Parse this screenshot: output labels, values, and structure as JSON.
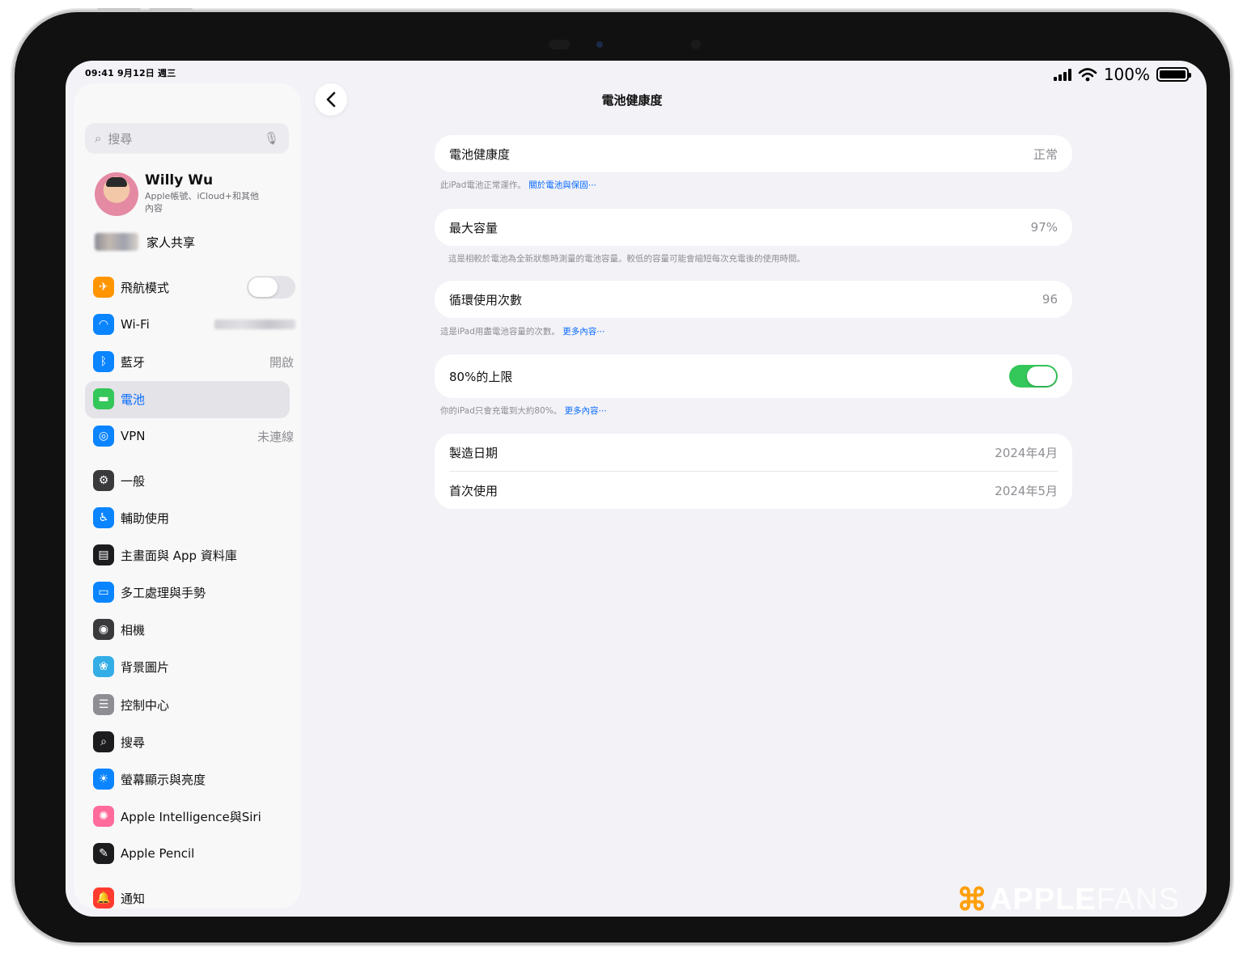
{
  "status_bar": {
    "time_date": "09:41  9月12日 週三",
    "battery_percent": "100%"
  },
  "sidebar": {
    "search_placeholder": "搜尋",
    "profile": {
      "name": "Willy Wu",
      "subtitle": "Apple帳號、iCloud+和其他內容"
    },
    "family_label": "家人共享",
    "items": [
      {
        "label": "飛航模式",
        "icon": "airplane-icon",
        "color": "#ff9500",
        "glyph": "✈",
        "toggle": false
      },
      {
        "label": "Wi-Fi",
        "icon": "wifi-icon",
        "color": "#0a84ff",
        "glyph": "◠"
      },
      {
        "label": "藍牙",
        "icon": "bluetooth-icon",
        "color": "#0a84ff",
        "glyph": "ᛒ",
        "value": "開啟"
      },
      {
        "label": "電池",
        "icon": "battery-icon",
        "color": "#34c759",
        "glyph": "▬",
        "selected": true
      },
      {
        "label": "VPN",
        "icon": "vpn-globe-icon",
        "color": "#0a84ff",
        "glyph": "◎",
        "value": "未連線"
      },
      {
        "label": "一般",
        "icon": "gear-icon",
        "color": "#3a3a3c",
        "glyph": "⚙"
      },
      {
        "label": "輔助使用",
        "icon": "accessibility-icon",
        "color": "#0a84ff",
        "glyph": "♿"
      },
      {
        "label": "主畫面與 App 資料庫",
        "icon": "home-screen-icon",
        "color": "#1c1c1e",
        "glyph": "▤"
      },
      {
        "label": "多工處理與手勢",
        "icon": "multitasking-icon",
        "color": "#0a84ff",
        "glyph": "▭"
      },
      {
        "label": "相機",
        "icon": "camera-icon",
        "color": "#3a3a3c",
        "glyph": "◉"
      },
      {
        "label": "背景圖片",
        "icon": "wallpaper-flower-icon",
        "color": "#32ade6",
        "glyph": "❀"
      },
      {
        "label": "控制中心",
        "icon": "control-center-icon",
        "color": "#8e8e93",
        "glyph": "☰"
      },
      {
        "label": "搜尋",
        "icon": "search-icon",
        "color": "#1c1c1e",
        "glyph": "⌕"
      },
      {
        "label": "螢幕顯示與亮度",
        "icon": "brightness-icon",
        "color": "#0a84ff",
        "glyph": "☀"
      },
      {
        "label": "Apple Intelligence與Siri",
        "icon": "apple-intelligence-icon",
        "color": "#ff6b9a",
        "glyph": "✺"
      },
      {
        "label": "Apple Pencil",
        "icon": "pencil-icon",
        "color": "#1c1c1e",
        "glyph": "✎"
      },
      {
        "label": "通知",
        "icon": "notification-bell-icon",
        "color": "#ff3b30",
        "glyph": "🔔"
      }
    ]
  },
  "main": {
    "title": "電池健康度",
    "back_label": "‹",
    "health": {
      "label": "電池健康度",
      "value": "正常"
    },
    "health_note": "此iPad電池正常運作。",
    "health_link": "關於電池與保固⋯",
    "capacity": {
      "label": "最大容量",
      "value": "97%"
    },
    "capacity_note": "這是相較於電池為全新狀態時測量的電池容量。較低的容量可能會縮短每次充電後的使用時間。",
    "cycles": {
      "label": "循環使用次數",
      "value": "96"
    },
    "cycles_note": "這是iPad用盡電池容量的次數。",
    "cycles_link": "更多內容⋯",
    "limit": {
      "label": "80%的上限",
      "toggle": true
    },
    "limit_note": "你的iPad只會充電到大約80%。",
    "limit_link": "更多內容⋯",
    "manufacture": {
      "label": "製造日期",
      "value": "2024年4月"
    },
    "first_use": {
      "label": "首次使用",
      "value": "2024年5月"
    }
  },
  "watermark": {
    "symbol": "⌘",
    "bold": "APPLE",
    "thin": "FANS"
  },
  "colors": {
    "accent": "#0a6cff",
    "toggle_on": "#34c759",
    "background": "#f2f2f7"
  }
}
